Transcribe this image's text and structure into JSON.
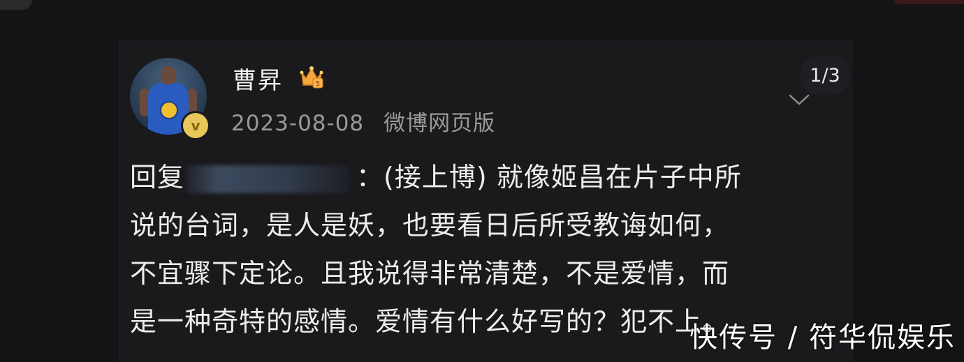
{
  "post": {
    "username": "曹昇",
    "date": "2023-08-08",
    "source": "微博网页版",
    "page_indicator": "1/3",
    "reply_prefix": "回复",
    "reply_text_1": "：(接上博) 就像姬昌在片子中所",
    "reply_text_2": "说的台词，是人是妖，也要看日后所受教诲如何，",
    "reply_text_3": "不宜骤下定论。且我说得非常清楚，不是爱情，而",
    "reply_text_4": "是一种奇特的感情。爱情有什么好写的？犯不上。"
  },
  "watermark": "快传号 / 符华侃娱乐",
  "colors": {
    "background": "#141316",
    "card": "#1a191c",
    "text": "#ededed",
    "meta_text": "#9a9a9c",
    "verified_badge": "#e8c85a"
  },
  "icons": {
    "avatar": "basketball-player-avatar",
    "verified": "verified-v-icon",
    "crown": "crown-badge-icon",
    "chevron": "chevron-down-icon"
  }
}
